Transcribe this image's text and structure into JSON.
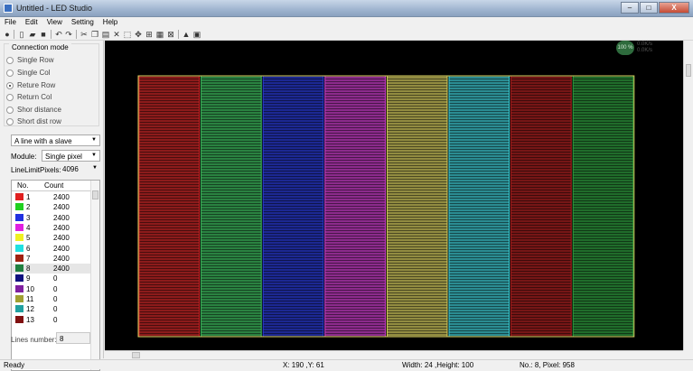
{
  "window": {
    "title": "Untitled - LED Studio",
    "minimize": "–",
    "maximize": "□",
    "close": "X"
  },
  "menu": [
    "File",
    "Edit",
    "View",
    "Setting",
    "Help"
  ],
  "sidebar": {
    "connection_mode": {
      "title": "Connection mode",
      "options": [
        {
          "label": "Single Row",
          "checked": false
        },
        {
          "label": "Single Col",
          "checked": false
        },
        {
          "label": "Reture Row",
          "checked": true
        },
        {
          "label": "Return Col",
          "checked": false
        },
        {
          "label": "Shor distance",
          "checked": false
        },
        {
          "label": "Short dist row",
          "checked": false
        }
      ]
    },
    "slave_mode": "A line with a slave",
    "module_label": "Module:",
    "module_value": "Single pixel",
    "line_limit_label": "LineLimitPixels:",
    "line_limit_value": "4096",
    "list": {
      "col_no": "No.",
      "col_count": "Count",
      "rows": [
        {
          "no": "1",
          "count": "2400",
          "color": "#e02020"
        },
        {
          "no": "2",
          "count": "2400",
          "color": "#20d020"
        },
        {
          "no": "3",
          "count": "2400",
          "color": "#2030e0"
        },
        {
          "no": "4",
          "count": "2400",
          "color": "#e020e0"
        },
        {
          "no": "5",
          "count": "2400",
          "color": "#f0f020"
        },
        {
          "no": "6",
          "count": "2400",
          "color": "#20e0e0"
        },
        {
          "no": "7",
          "count": "2400",
          "color": "#a02010"
        },
        {
          "no": "8",
          "count": "2400",
          "color": "#208040"
        },
        {
          "no": "9",
          "count": "0",
          "color": "#101080"
        },
        {
          "no": "10",
          "count": "0",
          "color": "#8020a0"
        },
        {
          "no": "11",
          "count": "0",
          "color": "#a0a030"
        },
        {
          "no": "12",
          "count": "0",
          "color": "#20a0a0"
        },
        {
          "no": "13",
          "count": "0",
          "color": "#801010"
        }
      ]
    },
    "lines_number_label": "Lines number:",
    "lines_number_value": "8"
  },
  "canvas": {
    "badge_value": "100 %",
    "badge_line1": "0.0K/s",
    "badge_line2": "0.0K/s",
    "columns": [
      {
        "color": "#d02828"
      },
      {
        "color": "#3fc060"
      },
      {
        "color": "#2a3cd8"
      },
      {
        "color": "#d040d0"
      },
      {
        "color": "#d8d060"
      },
      {
        "color": "#40d0d8"
      },
      {
        "color": "#b02020"
      },
      {
        "color": "#30a040"
      }
    ],
    "border_color": "#d8d060"
  },
  "status": {
    "ready": "Ready",
    "coords": "X: 190 ,Y: 61",
    "size": "Width: 24 ,Height: 100",
    "info": "No.: 8, Pixel: 958"
  }
}
